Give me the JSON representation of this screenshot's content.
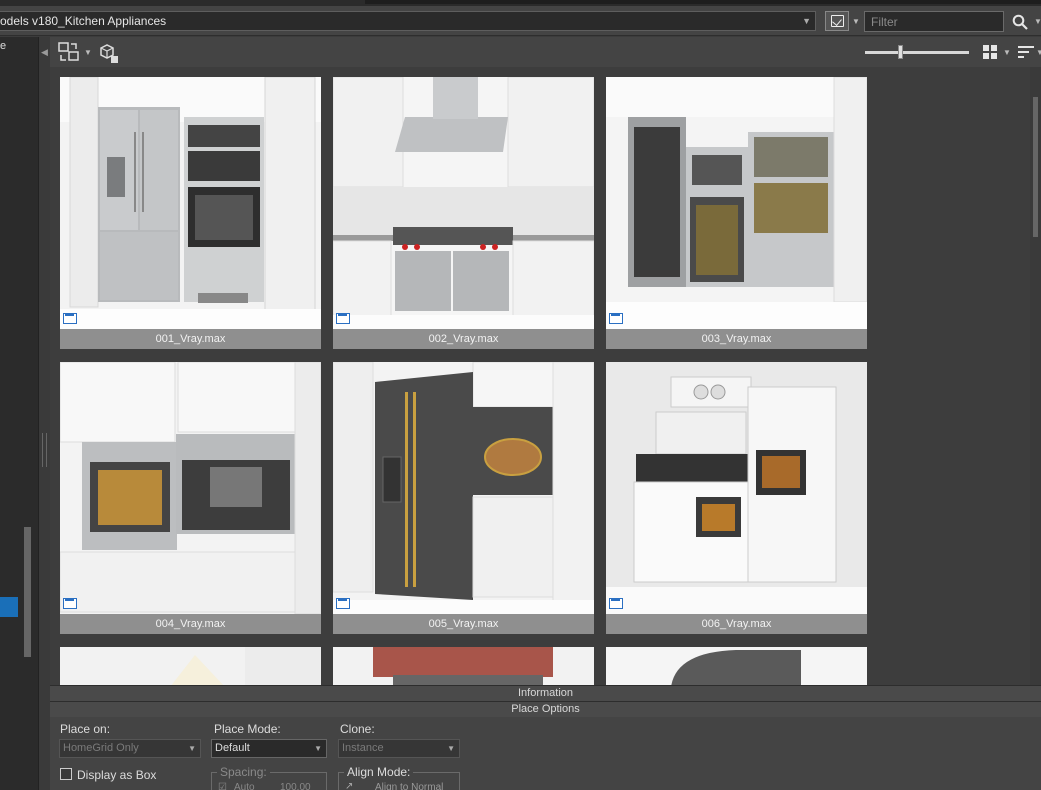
{
  "library": {
    "selected": "odels v180_Kitchen Appliances",
    "filter_placeholder": "Filter"
  },
  "left_panel": {
    "partial_text": "e"
  },
  "grid": {
    "items": [
      {
        "label": "001_Vray.max"
      },
      {
        "label": "002_Vray.max"
      },
      {
        "label": "003_Vray.max"
      },
      {
        "label": "004_Vray.max"
      },
      {
        "label": "005_Vray.max"
      },
      {
        "label": "006_Vray.max"
      }
    ]
  },
  "rollouts": {
    "information": "Information",
    "place_options": "Place Options"
  },
  "options": {
    "place_on_label": "Place on:",
    "place_on_value": "HomeGrid Only",
    "place_mode_label": "Place Mode:",
    "place_mode_value": "Default",
    "clone_label": "Clone:",
    "clone_value": "Instance",
    "display_as_box": "Display as Box",
    "spacing_label": "Spacing:",
    "spacing_auto": "Auto",
    "spacing_value": "100.00",
    "align_mode_label": "Align Mode:",
    "align_to_normal": "Align to Normal"
  },
  "colors": {
    "accent": "#1a6fb8",
    "panel": "#444444",
    "caption": "#8f8f8f"
  }
}
